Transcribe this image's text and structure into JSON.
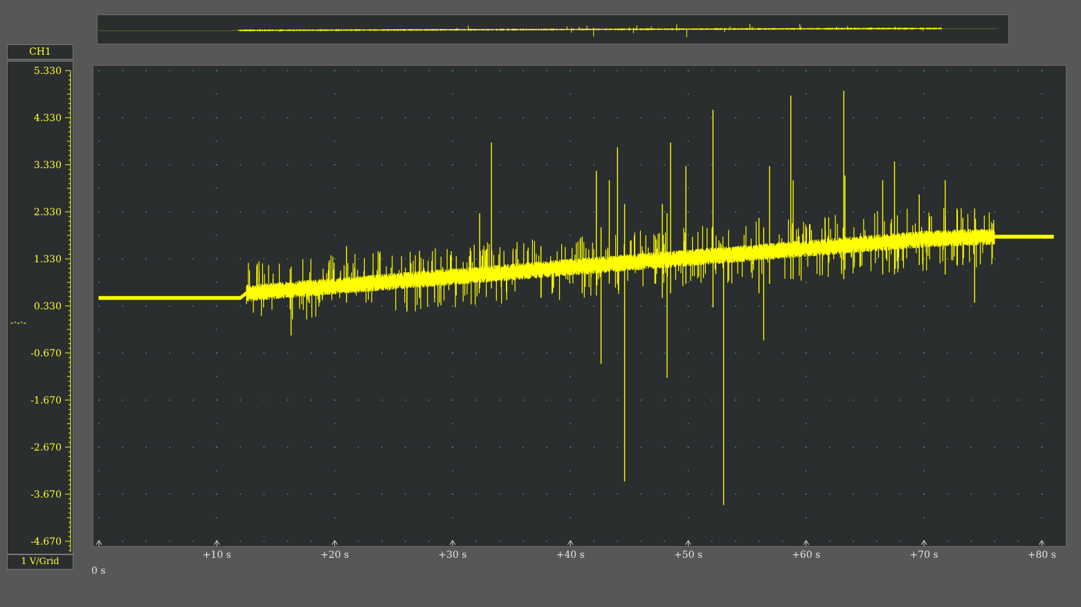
{
  "channel": {
    "name": "CH1",
    "scale_label": "1 V/Grid",
    "trigger_marker": "-·-·-",
    "y_ticks": [
      "5.330",
      "4.330",
      "3.330",
      "2.330",
      "1.330",
      "0.330",
      "-0.670",
      "-1.670",
      "-2.670",
      "-3.670",
      "-4.670"
    ]
  },
  "time_axis": {
    "origin_label": "0 s",
    "tick_labels": [
      "+10 s",
      "+20 s",
      "+30 s",
      "+40 s",
      "+50 s",
      "+60 s",
      "+70 s",
      "+80 s"
    ]
  },
  "colors": {
    "trace": "#ffff00",
    "grid_dots": "#2fb5a0",
    "background": "#2a2e2e",
    "frame": "#575757"
  },
  "chart_data": {
    "type": "line",
    "xlim": [
      0,
      81
    ],
    "ylim": [
      -4.8,
      5.33
    ],
    "x_unit": "s",
    "y_unit": "V",
    "baseline": [
      {
        "x": 0,
        "y": 0.5
      },
      {
        "x": 12,
        "y": 0.5
      },
      {
        "x": 12.5,
        "y": 0.6
      },
      {
        "x": 20,
        "y": 0.75
      },
      {
        "x": 30,
        "y": 0.95
      },
      {
        "x": 40,
        "y": 1.15
      },
      {
        "x": 50,
        "y": 1.35
      },
      {
        "x": 60,
        "y": 1.55
      },
      {
        "x": 70,
        "y": 1.75
      },
      {
        "x": 75.5,
        "y": 1.8
      },
      {
        "x": 76,
        "y": 1.8
      },
      {
        "x": 81,
        "y": 1.8
      }
    ],
    "noise_start": 12.5,
    "noise_end": 76,
    "noise_amplitude": 0.15,
    "spikes": [
      {
        "x": 16.3,
        "min": -0.3,
        "max": 0.9
      },
      {
        "x": 21.0,
        "min": 0.4,
        "max": 1.6
      },
      {
        "x": 27.2,
        "min": 0.5,
        "max": 1.5
      },
      {
        "x": 32.3,
        "min": 0.7,
        "max": 2.3
      },
      {
        "x": 33.3,
        "min": 0.7,
        "max": 3.8
      },
      {
        "x": 37.5,
        "min": 0.5,
        "max": 1.6
      },
      {
        "x": 41.0,
        "min": 0.6,
        "max": 1.8
      },
      {
        "x": 42.2,
        "min": 0.9,
        "max": 3.2
      },
      {
        "x": 42.6,
        "min": -0.9,
        "max": 2.0
      },
      {
        "x": 43.3,
        "min": 0.8,
        "max": 3.0
      },
      {
        "x": 44.0,
        "min": 0.8,
        "max": 3.7
      },
      {
        "x": 44.6,
        "min": -3.4,
        "max": 2.5
      },
      {
        "x": 47.8,
        "min": 0.5,
        "max": 2.5
      },
      {
        "x": 48.2,
        "min": -1.2,
        "max": 2.3
      },
      {
        "x": 48.5,
        "min": 0.6,
        "max": 3.8
      },
      {
        "x": 49.8,
        "min": 0.8,
        "max": 3.3
      },
      {
        "x": 52.1,
        "min": 0.3,
        "max": 4.5
      },
      {
        "x": 53.0,
        "min": -3.9,
        "max": 1.4
      },
      {
        "x": 56.0,
        "min": 0.6,
        "max": 2.2
      },
      {
        "x": 56.4,
        "min": -0.4,
        "max": 2.0
      },
      {
        "x": 56.9,
        "min": 0.8,
        "max": 3.3
      },
      {
        "x": 58.7,
        "min": 0.9,
        "max": 4.8
      },
      {
        "x": 58.9,
        "min": 0.9,
        "max": 3.0
      },
      {
        "x": 63.2,
        "min": 0.9,
        "max": 4.9
      },
      {
        "x": 63.3,
        "min": 1.1,
        "max": 3.1
      },
      {
        "x": 66.5,
        "min": 1.0,
        "max": 3.0
      },
      {
        "x": 67.5,
        "min": 1.0,
        "max": 3.4
      },
      {
        "x": 69.6,
        "min": 1.2,
        "max": 2.7
      },
      {
        "x": 71.8,
        "min": 1.0,
        "max": 3.0
      },
      {
        "x": 72.8,
        "min": 1.2,
        "max": 2.4
      },
      {
        "x": 73.3,
        "min": 1.2,
        "max": 2.2
      },
      {
        "x": 74.3,
        "min": 0.4,
        "max": 2.4
      }
    ]
  }
}
